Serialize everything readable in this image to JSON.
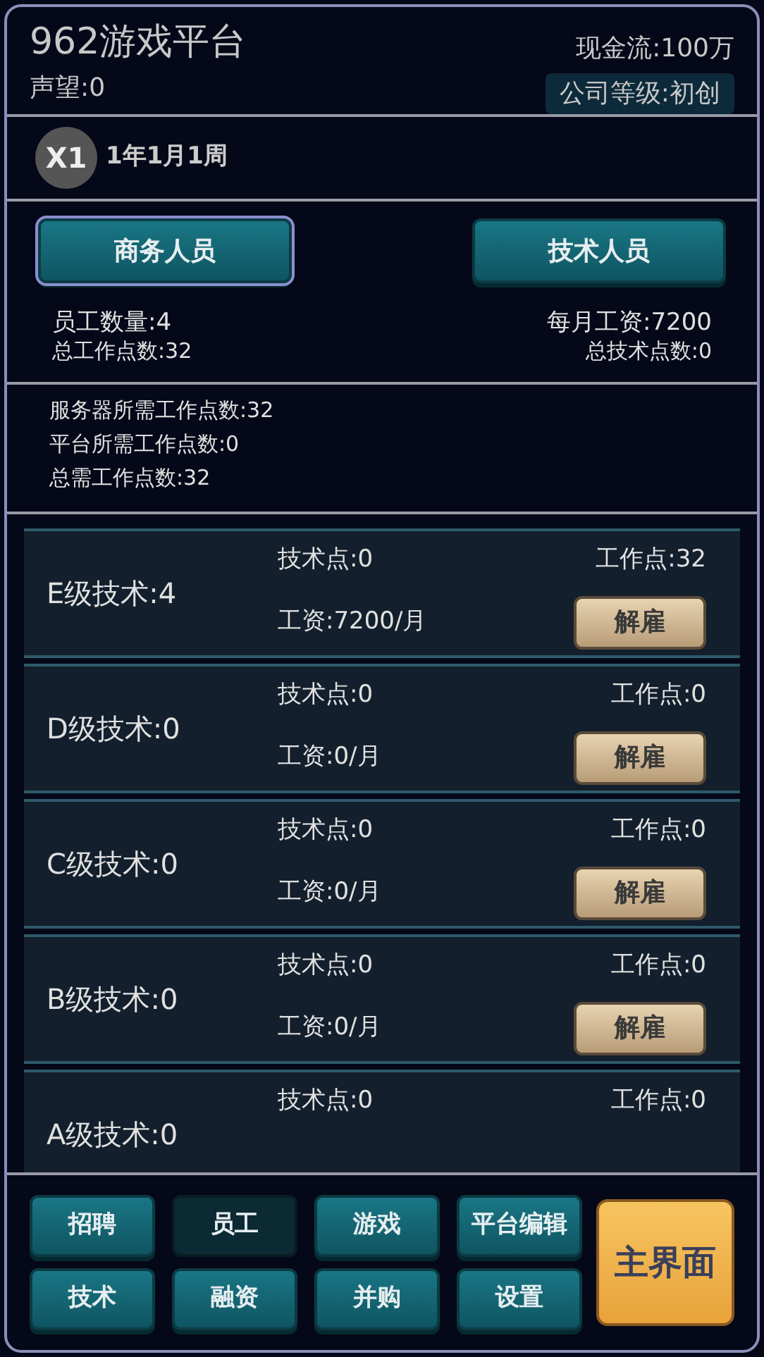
{
  "header": {
    "title": "962游戏平台",
    "cash": "现金流:100万",
    "reputation": "声望:0",
    "company_level": "公司等级:初创"
  },
  "time": {
    "speed": "X1",
    "date": "1年1月1周"
  },
  "tabs": [
    {
      "label": "商务人员",
      "selected": true
    },
    {
      "label": "技术人员",
      "selected": false
    }
  ],
  "stats": {
    "employees": "员工数量:4",
    "monthly_salary": "每月工资:7200",
    "total_work_points": "总工作点数:32",
    "total_tech_points": "总技术点数:0"
  },
  "requirements": [
    "服务器所需工作点数:32",
    "平台所需工作点数:0",
    "总需工作点数:32"
  ],
  "staff": [
    {
      "name": "E级技术:4",
      "tech_points": "技术点:0",
      "work_points": "工作点:32",
      "salary": "工资:7200/月",
      "action": "解雇"
    },
    {
      "name": "D级技术:0",
      "tech_points": "技术点:0",
      "work_points": "工作点:0",
      "salary": "工资:0/月",
      "action": "解雇"
    },
    {
      "name": "C级技术:0",
      "tech_points": "技术点:0",
      "work_points": "工作点:0",
      "salary": "工资:0/月",
      "action": "解雇"
    },
    {
      "name": "B级技术:0",
      "tech_points": "技术点:0",
      "work_points": "工作点:0",
      "salary": "工资:0/月",
      "action": "解雇"
    },
    {
      "name": "A级技术:0",
      "tech_points": "技术点:0",
      "work_points": "工作点:0"
    }
  ],
  "nav": [
    {
      "label": "招聘",
      "selected": false
    },
    {
      "label": "员工",
      "selected": true
    },
    {
      "label": "游戏",
      "selected": false
    },
    {
      "label": "平台编辑",
      "selected": false
    },
    {
      "label": "技术",
      "selected": false
    },
    {
      "label": "融资",
      "selected": false
    },
    {
      "label": "并购",
      "selected": false
    },
    {
      "label": "设置",
      "selected": false
    }
  ],
  "main_button": "主界面"
}
